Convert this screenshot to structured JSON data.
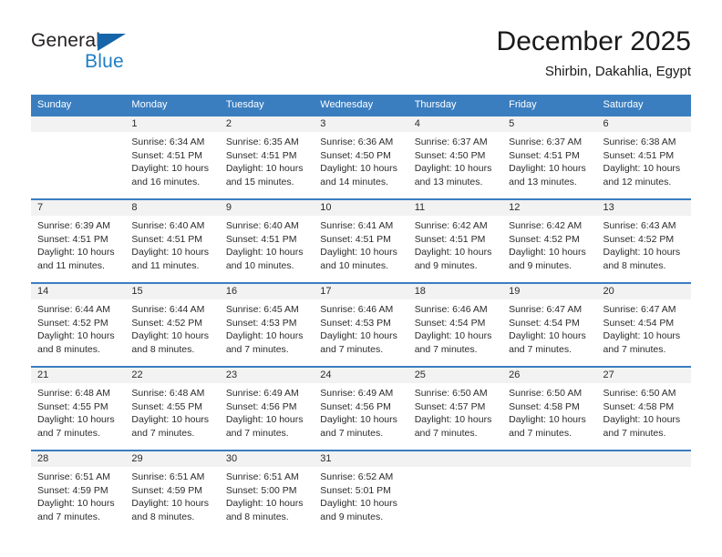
{
  "brand": {
    "name_part1": "General",
    "name_part2": "Blue",
    "accent_color": "#1f7fc4",
    "triangle_color": "#1565a8"
  },
  "header": {
    "title": "December 2025",
    "subtitle": "Shirbin, Dakahlia, Egypt"
  },
  "theme": {
    "header_row_bg": "#3a7ec0",
    "day_band_bg": "#f2f2f2",
    "grid_line": "#3a7ec0",
    "text": "#2b2b2b"
  },
  "weekday_headers": [
    "Sunday",
    "Monday",
    "Tuesday",
    "Wednesday",
    "Thursday",
    "Friday",
    "Saturday"
  ],
  "labels": {
    "sunrise_prefix": "Sunrise:",
    "sunset_prefix": "Sunset:",
    "daylight_prefix": "Daylight:"
  },
  "weeks": [
    [
      {
        "day": "",
        "sunrise": "",
        "sunset": "",
        "daylight_line1": "",
        "daylight_line2": ""
      },
      {
        "day": "1",
        "sunrise": "Sunrise: 6:34 AM",
        "sunset": "Sunset: 4:51 PM",
        "daylight_line1": "Daylight: 10 hours",
        "daylight_line2": "and 16 minutes."
      },
      {
        "day": "2",
        "sunrise": "Sunrise: 6:35 AM",
        "sunset": "Sunset: 4:51 PM",
        "daylight_line1": "Daylight: 10 hours",
        "daylight_line2": "and 15 minutes."
      },
      {
        "day": "3",
        "sunrise": "Sunrise: 6:36 AM",
        "sunset": "Sunset: 4:50 PM",
        "daylight_line1": "Daylight: 10 hours",
        "daylight_line2": "and 14 minutes."
      },
      {
        "day": "4",
        "sunrise": "Sunrise: 6:37 AM",
        "sunset": "Sunset: 4:50 PM",
        "daylight_line1": "Daylight: 10 hours",
        "daylight_line2": "and 13 minutes."
      },
      {
        "day": "5",
        "sunrise": "Sunrise: 6:37 AM",
        "sunset": "Sunset: 4:51 PM",
        "daylight_line1": "Daylight: 10 hours",
        "daylight_line2": "and 13 minutes."
      },
      {
        "day": "6",
        "sunrise": "Sunrise: 6:38 AM",
        "sunset": "Sunset: 4:51 PM",
        "daylight_line1": "Daylight: 10 hours",
        "daylight_line2": "and 12 minutes."
      }
    ],
    [
      {
        "day": "7",
        "sunrise": "Sunrise: 6:39 AM",
        "sunset": "Sunset: 4:51 PM",
        "daylight_line1": "Daylight: 10 hours",
        "daylight_line2": "and 11 minutes."
      },
      {
        "day": "8",
        "sunrise": "Sunrise: 6:40 AM",
        "sunset": "Sunset: 4:51 PM",
        "daylight_line1": "Daylight: 10 hours",
        "daylight_line2": "and 11 minutes."
      },
      {
        "day": "9",
        "sunrise": "Sunrise: 6:40 AM",
        "sunset": "Sunset: 4:51 PM",
        "daylight_line1": "Daylight: 10 hours",
        "daylight_line2": "and 10 minutes."
      },
      {
        "day": "10",
        "sunrise": "Sunrise: 6:41 AM",
        "sunset": "Sunset: 4:51 PM",
        "daylight_line1": "Daylight: 10 hours",
        "daylight_line2": "and 10 minutes."
      },
      {
        "day": "11",
        "sunrise": "Sunrise: 6:42 AM",
        "sunset": "Sunset: 4:51 PM",
        "daylight_line1": "Daylight: 10 hours",
        "daylight_line2": "and 9 minutes."
      },
      {
        "day": "12",
        "sunrise": "Sunrise: 6:42 AM",
        "sunset": "Sunset: 4:52 PM",
        "daylight_line1": "Daylight: 10 hours",
        "daylight_line2": "and 9 minutes."
      },
      {
        "day": "13",
        "sunrise": "Sunrise: 6:43 AM",
        "sunset": "Sunset: 4:52 PM",
        "daylight_line1": "Daylight: 10 hours",
        "daylight_line2": "and 8 minutes."
      }
    ],
    [
      {
        "day": "14",
        "sunrise": "Sunrise: 6:44 AM",
        "sunset": "Sunset: 4:52 PM",
        "daylight_line1": "Daylight: 10 hours",
        "daylight_line2": "and 8 minutes."
      },
      {
        "day": "15",
        "sunrise": "Sunrise: 6:44 AM",
        "sunset": "Sunset: 4:52 PM",
        "daylight_line1": "Daylight: 10 hours",
        "daylight_line2": "and 8 minutes."
      },
      {
        "day": "16",
        "sunrise": "Sunrise: 6:45 AM",
        "sunset": "Sunset: 4:53 PM",
        "daylight_line1": "Daylight: 10 hours",
        "daylight_line2": "and 7 minutes."
      },
      {
        "day": "17",
        "sunrise": "Sunrise: 6:46 AM",
        "sunset": "Sunset: 4:53 PM",
        "daylight_line1": "Daylight: 10 hours",
        "daylight_line2": "and 7 minutes."
      },
      {
        "day": "18",
        "sunrise": "Sunrise: 6:46 AM",
        "sunset": "Sunset: 4:54 PM",
        "daylight_line1": "Daylight: 10 hours",
        "daylight_line2": "and 7 minutes."
      },
      {
        "day": "19",
        "sunrise": "Sunrise: 6:47 AM",
        "sunset": "Sunset: 4:54 PM",
        "daylight_line1": "Daylight: 10 hours",
        "daylight_line2": "and 7 minutes."
      },
      {
        "day": "20",
        "sunrise": "Sunrise: 6:47 AM",
        "sunset": "Sunset: 4:54 PM",
        "daylight_line1": "Daylight: 10 hours",
        "daylight_line2": "and 7 minutes."
      }
    ],
    [
      {
        "day": "21",
        "sunrise": "Sunrise: 6:48 AM",
        "sunset": "Sunset: 4:55 PM",
        "daylight_line1": "Daylight: 10 hours",
        "daylight_line2": "and 7 minutes."
      },
      {
        "day": "22",
        "sunrise": "Sunrise: 6:48 AM",
        "sunset": "Sunset: 4:55 PM",
        "daylight_line1": "Daylight: 10 hours",
        "daylight_line2": "and 7 minutes."
      },
      {
        "day": "23",
        "sunrise": "Sunrise: 6:49 AM",
        "sunset": "Sunset: 4:56 PM",
        "daylight_line1": "Daylight: 10 hours",
        "daylight_line2": "and 7 minutes."
      },
      {
        "day": "24",
        "sunrise": "Sunrise: 6:49 AM",
        "sunset": "Sunset: 4:56 PM",
        "daylight_line1": "Daylight: 10 hours",
        "daylight_line2": "and 7 minutes."
      },
      {
        "day": "25",
        "sunrise": "Sunrise: 6:50 AM",
        "sunset": "Sunset: 4:57 PM",
        "daylight_line1": "Daylight: 10 hours",
        "daylight_line2": "and 7 minutes."
      },
      {
        "day": "26",
        "sunrise": "Sunrise: 6:50 AM",
        "sunset": "Sunset: 4:58 PM",
        "daylight_line1": "Daylight: 10 hours",
        "daylight_line2": "and 7 minutes."
      },
      {
        "day": "27",
        "sunrise": "Sunrise: 6:50 AM",
        "sunset": "Sunset: 4:58 PM",
        "daylight_line1": "Daylight: 10 hours",
        "daylight_line2": "and 7 minutes."
      }
    ],
    [
      {
        "day": "28",
        "sunrise": "Sunrise: 6:51 AM",
        "sunset": "Sunset: 4:59 PM",
        "daylight_line1": "Daylight: 10 hours",
        "daylight_line2": "and 7 minutes."
      },
      {
        "day": "29",
        "sunrise": "Sunrise: 6:51 AM",
        "sunset": "Sunset: 4:59 PM",
        "daylight_line1": "Daylight: 10 hours",
        "daylight_line2": "and 8 minutes."
      },
      {
        "day": "30",
        "sunrise": "Sunrise: 6:51 AM",
        "sunset": "Sunset: 5:00 PM",
        "daylight_line1": "Daylight: 10 hours",
        "daylight_line2": "and 8 minutes."
      },
      {
        "day": "31",
        "sunrise": "Sunrise: 6:52 AM",
        "sunset": "Sunset: 5:01 PM",
        "daylight_line1": "Daylight: 10 hours",
        "daylight_line2": "and 9 minutes."
      },
      {
        "day": "",
        "sunrise": "",
        "sunset": "",
        "daylight_line1": "",
        "daylight_line2": ""
      },
      {
        "day": "",
        "sunrise": "",
        "sunset": "",
        "daylight_line1": "",
        "daylight_line2": ""
      },
      {
        "day": "",
        "sunrise": "",
        "sunset": "",
        "daylight_line1": "",
        "daylight_line2": ""
      }
    ]
  ]
}
